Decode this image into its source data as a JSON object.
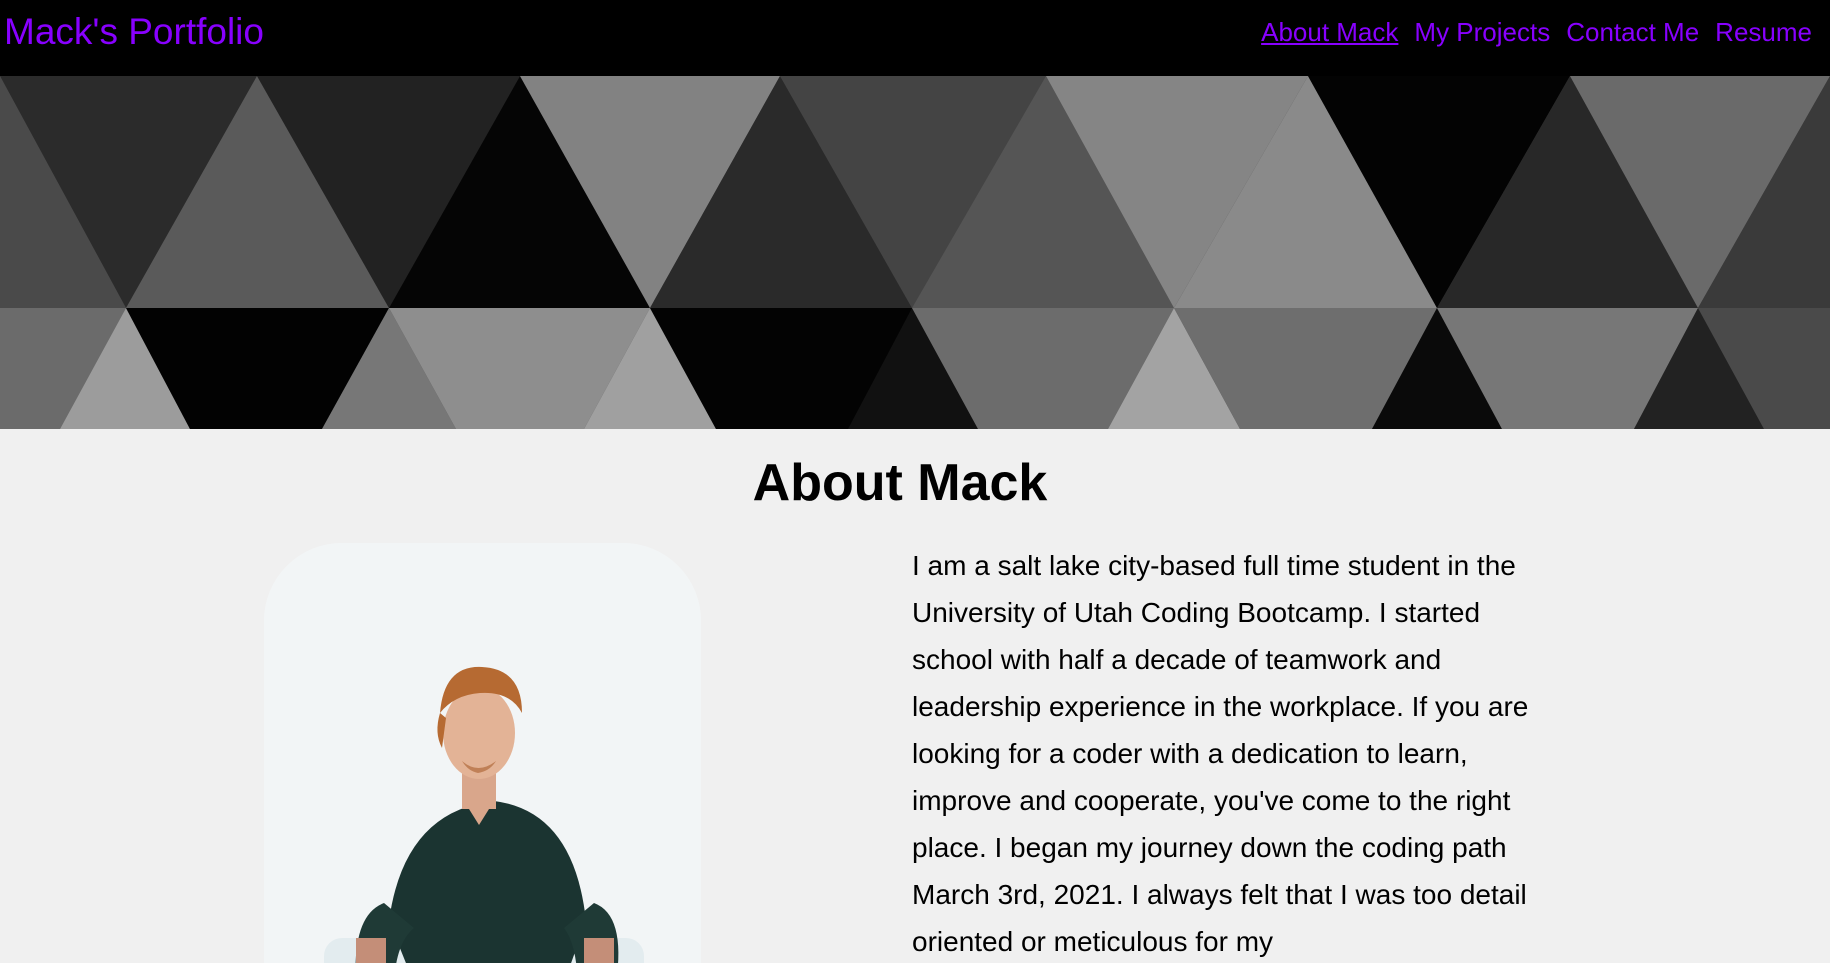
{
  "header": {
    "brand": "Mack's Portfolio",
    "nav": [
      {
        "label": "About Mack",
        "active": true
      },
      {
        "label": "My Projects"
      },
      {
        "label": "Contact Me"
      },
      {
        "label": "Resume"
      }
    ]
  },
  "about": {
    "heading": "About Mack",
    "portrait_icon": "portrait-photo",
    "bio": "I am a salt lake city-based full time student in the University of Utah Coding Bootcamp. I started school with half a decade of teamwork and leadership experience in the workplace. If you are looking for a coder with a dedication to learn, improve and cooperate, you've come to the right place. I began my journey down the coding path March 3rd, 2021. I always felt that I was too detail oriented or meticulous for my"
  },
  "colors": {
    "accent": "#8800ff",
    "header_bg": "#000000",
    "page_bg": "#f0f0f0"
  }
}
